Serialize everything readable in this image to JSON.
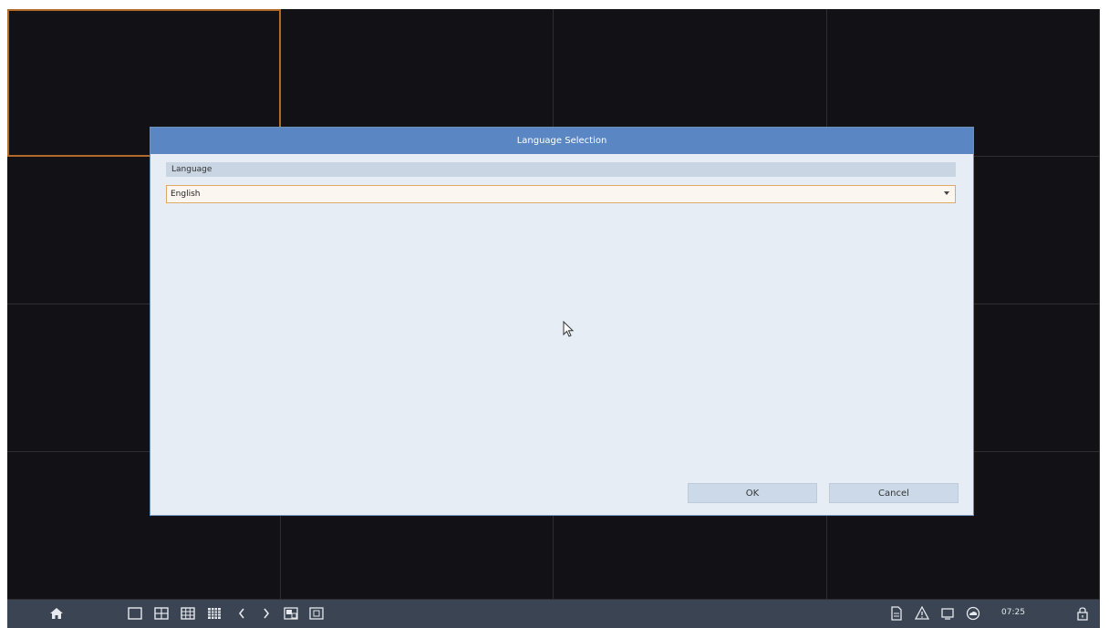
{
  "dialog": {
    "title": "Language Selection",
    "section_label": "Language",
    "language_select": {
      "selected_value": "English"
    },
    "ok_label": "OK",
    "cancel_label": "Cancel"
  },
  "taskbar": {
    "home_icon": "home-icon",
    "layout_icons": [
      "layout-1-icon",
      "layout-4-icon",
      "layout-9-icon",
      "layout-16-icon"
    ],
    "prev_icon": "chevron-left-icon",
    "next_icon": "chevron-right-icon",
    "extra_icons": [
      "picture-in-picture-icon",
      "fullscreen-icon"
    ],
    "status_icons": [
      "document-icon",
      "alarm-icon",
      "network-icon",
      "cloud-icon"
    ],
    "time": "07:25",
    "lock_icon": "lock-icon"
  },
  "colors": {
    "title_bar": "#5a86c3",
    "dialog_bg": "#e6edf5",
    "screen_bg": "#121216",
    "selected_cell": "#b06a2a",
    "taskbar": "#3a4452"
  }
}
